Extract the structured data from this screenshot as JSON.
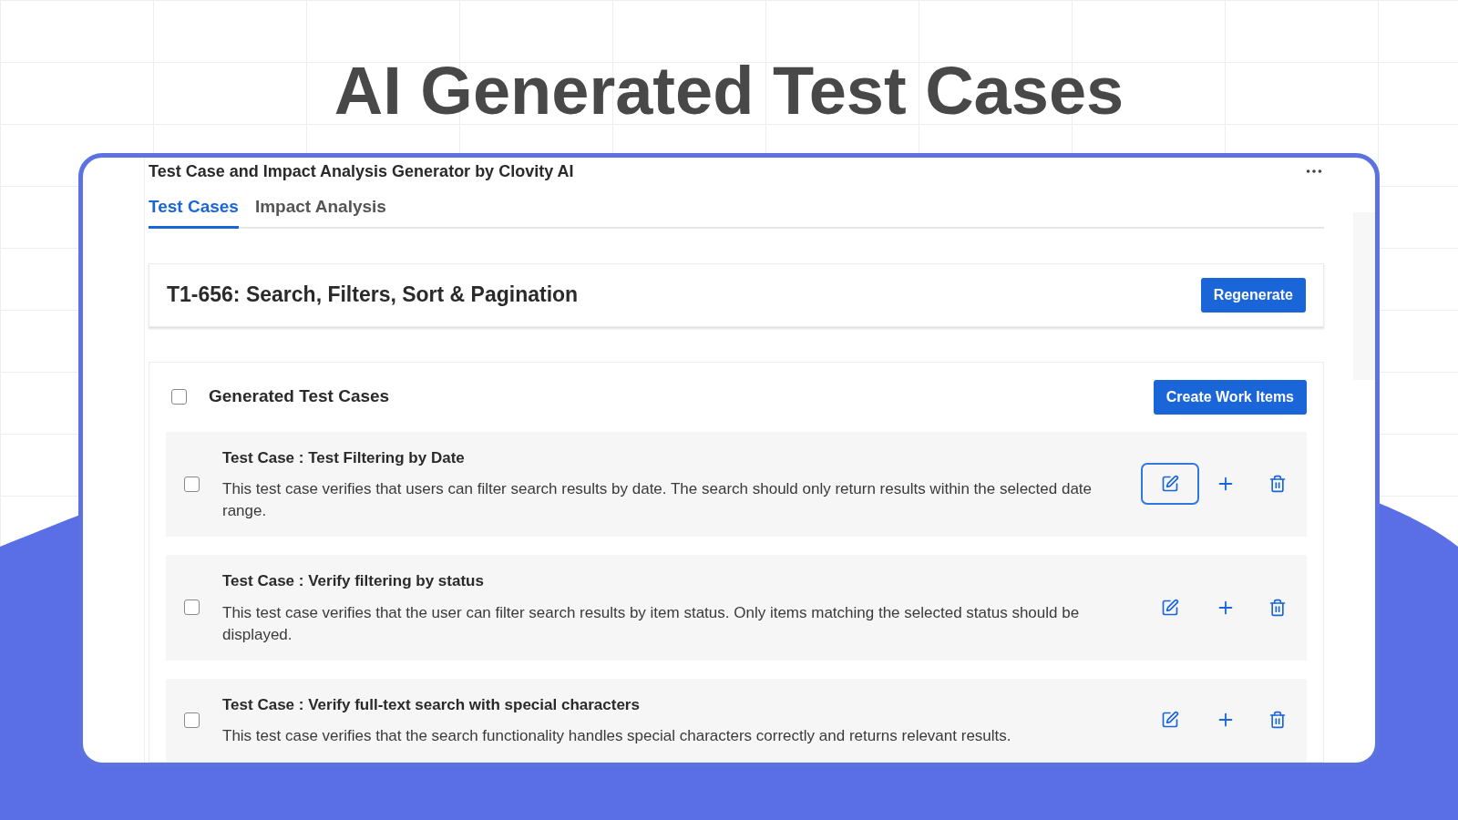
{
  "heading": "AI Generated Test Cases",
  "app": {
    "title": "Test Case and Impact Analysis Generator by Clovity AI",
    "tabs": [
      {
        "label": "Test Cases",
        "selected": true
      },
      {
        "label": "Impact Analysis",
        "selected": false
      }
    ],
    "work_item": {
      "title": "T1-656: Search, Filters, Sort & Pagination",
      "button": "Regenerate"
    },
    "generated": {
      "title": "Generated Test Cases",
      "checked": false,
      "button": "Create Work Items",
      "items": [
        {
          "title": "Test Case : Test Filtering by Date",
          "description": "This test case verifies that users can filter search results by date. The search should only return results within the selected date range.",
          "checked": false,
          "edit_focused": true
        },
        {
          "title": "Test Case : Verify filtering by status",
          "description": "This test case verifies that the user can filter search results by item status. Only items matching the selected status should be displayed.",
          "checked": false,
          "edit_focused": false
        },
        {
          "title": "Test Case : Verify full-text search with special characters",
          "description": "This test case verifies that the search functionality handles special characters correctly and returns relevant results.",
          "checked": false,
          "edit_focused": false
        }
      ]
    }
  }
}
